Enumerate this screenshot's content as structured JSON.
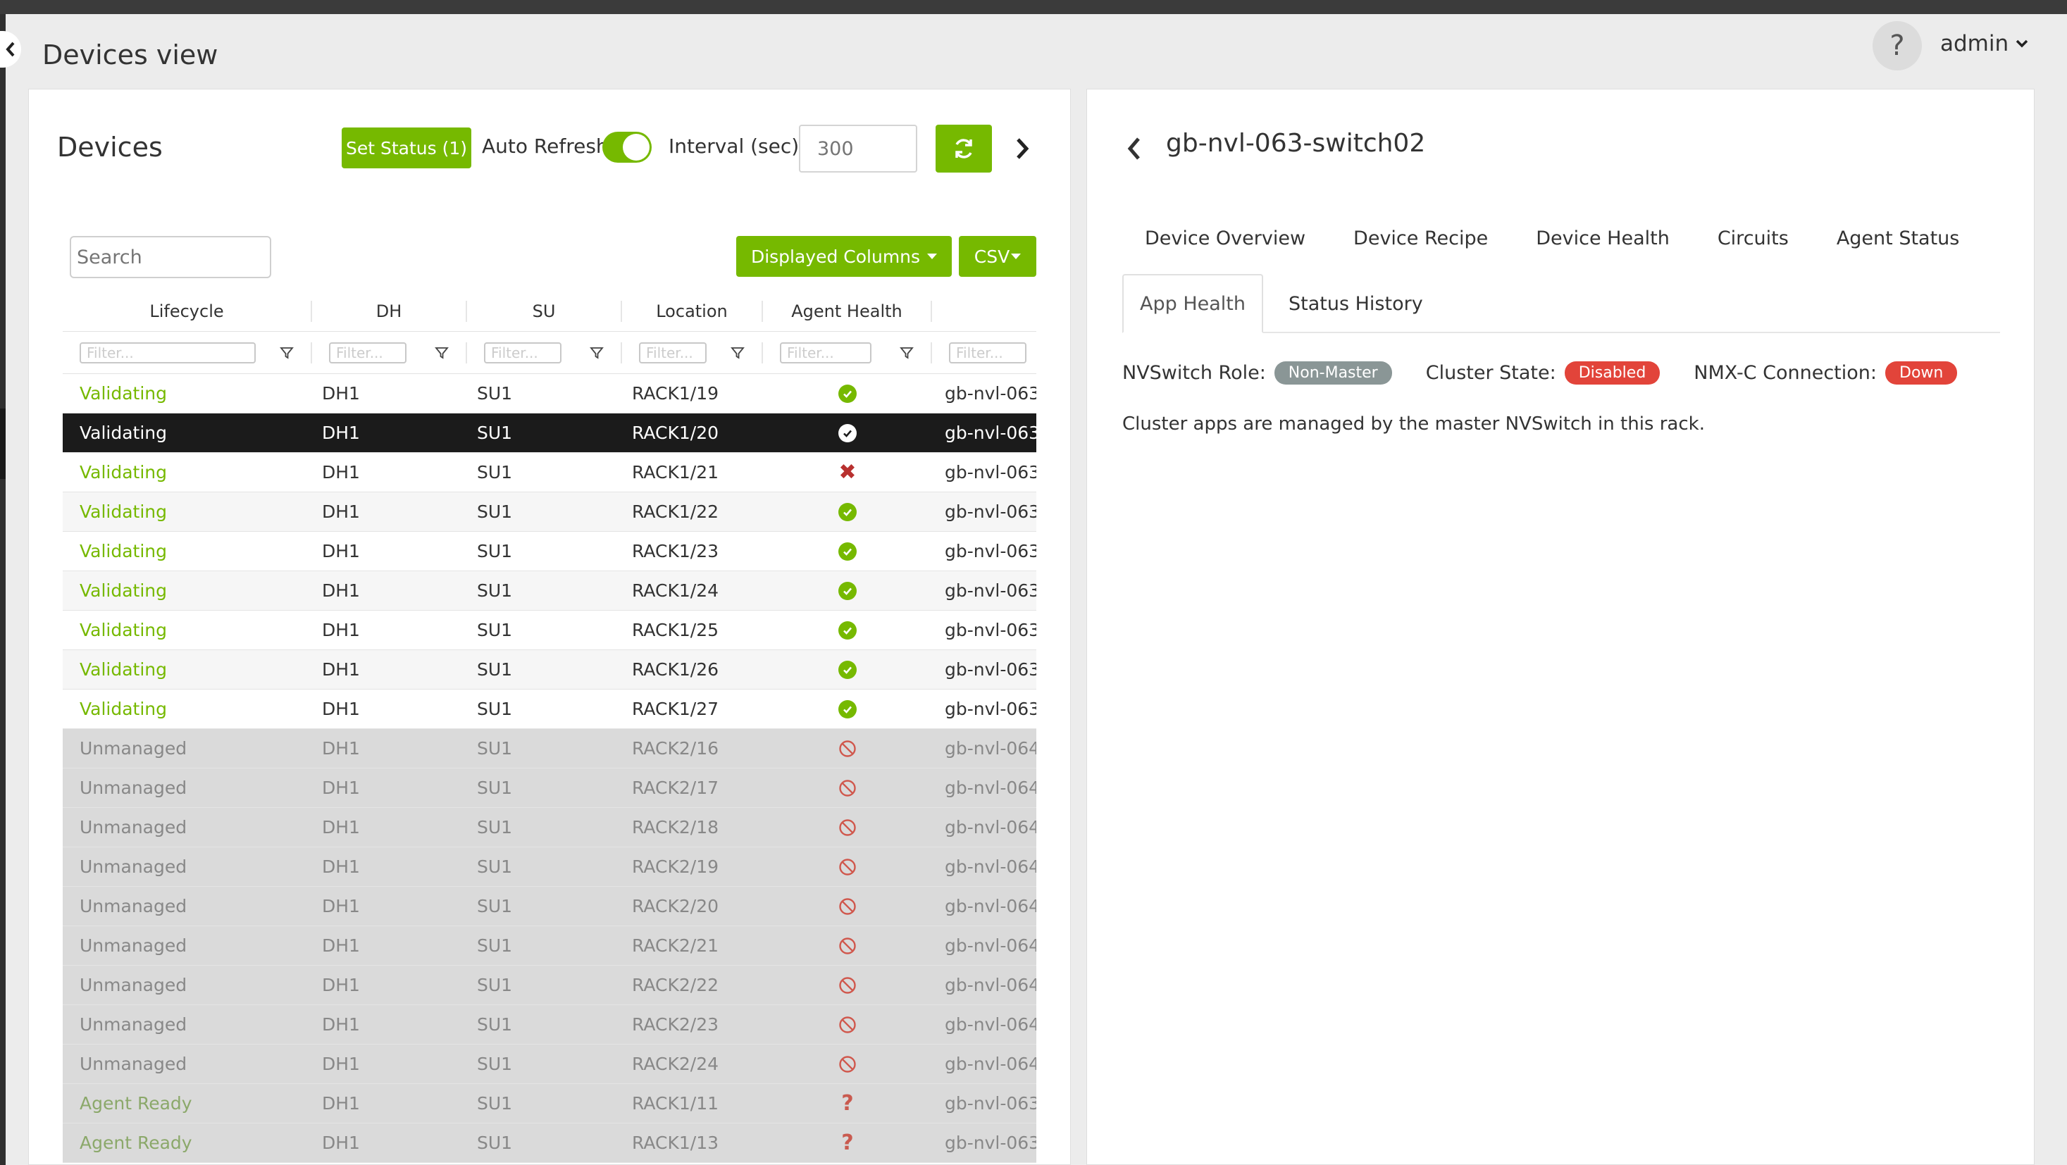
{
  "header": {
    "title": "Devices view",
    "help_label": "?",
    "user": "admin"
  },
  "devices_panel": {
    "title": "Devices",
    "set_status_label": "Set Status (1)",
    "auto_refresh_label": "Auto Refresh",
    "auto_refresh_on": true,
    "interval_label": "Interval (sec)",
    "interval_placeholder": "300",
    "search_placeholder": "Search",
    "displayed_columns_label": "Displayed Columns",
    "csv_label": "CSV",
    "columns": [
      "Lifecycle",
      "DH",
      "SU",
      "Location",
      "Agent Health"
    ],
    "filter_placeholder": "Filter...",
    "rows": [
      {
        "lifecycle": "Validating",
        "dh": "DH1",
        "su": "SU1",
        "location": "RACK1/19",
        "health": "ok",
        "name": "gb-nvl-063"
      },
      {
        "lifecycle": "Validating",
        "dh": "DH1",
        "su": "SU1",
        "location": "RACK1/20",
        "health": "ok",
        "name": "gb-nvl-063"
      },
      {
        "lifecycle": "Validating",
        "dh": "DH1",
        "su": "SU1",
        "location": "RACK1/21",
        "health": "fail",
        "name": "gb-nvl-063"
      },
      {
        "lifecycle": "Validating",
        "dh": "DH1",
        "su": "SU1",
        "location": "RACK1/22",
        "health": "ok",
        "name": "gb-nvl-063"
      },
      {
        "lifecycle": "Validating",
        "dh": "DH1",
        "su": "SU1",
        "location": "RACK1/23",
        "health": "ok",
        "name": "gb-nvl-063"
      },
      {
        "lifecycle": "Validating",
        "dh": "DH1",
        "su": "SU1",
        "location": "RACK1/24",
        "health": "ok",
        "name": "gb-nvl-063"
      },
      {
        "lifecycle": "Validating",
        "dh": "DH1",
        "su": "SU1",
        "location": "RACK1/25",
        "health": "ok",
        "name": "gb-nvl-063"
      },
      {
        "lifecycle": "Validating",
        "dh": "DH1",
        "su": "SU1",
        "location": "RACK1/26",
        "health": "ok",
        "name": "gb-nvl-063"
      },
      {
        "lifecycle": "Validating",
        "dh": "DH1",
        "su": "SU1",
        "location": "RACK1/27",
        "health": "ok",
        "name": "gb-nvl-063"
      },
      {
        "lifecycle": "Unmanaged",
        "dh": "DH1",
        "su": "SU1",
        "location": "RACK2/16",
        "health": "disabled",
        "name": "gb-nvl-064"
      },
      {
        "lifecycle": "Unmanaged",
        "dh": "DH1",
        "su": "SU1",
        "location": "RACK2/17",
        "health": "disabled",
        "name": "gb-nvl-064"
      },
      {
        "lifecycle": "Unmanaged",
        "dh": "DH1",
        "su": "SU1",
        "location": "RACK2/18",
        "health": "disabled",
        "name": "gb-nvl-064"
      },
      {
        "lifecycle": "Unmanaged",
        "dh": "DH1",
        "su": "SU1",
        "location": "RACK2/19",
        "health": "disabled",
        "name": "gb-nvl-064"
      },
      {
        "lifecycle": "Unmanaged",
        "dh": "DH1",
        "su": "SU1",
        "location": "RACK2/20",
        "health": "disabled",
        "name": "gb-nvl-064"
      },
      {
        "lifecycle": "Unmanaged",
        "dh": "DH1",
        "su": "SU1",
        "location": "RACK2/21",
        "health": "disabled",
        "name": "gb-nvl-064"
      },
      {
        "lifecycle": "Unmanaged",
        "dh": "DH1",
        "su": "SU1",
        "location": "RACK2/22",
        "health": "disabled",
        "name": "gb-nvl-064"
      },
      {
        "lifecycle": "Unmanaged",
        "dh": "DH1",
        "su": "SU1",
        "location": "RACK2/23",
        "health": "disabled",
        "name": "gb-nvl-064"
      },
      {
        "lifecycle": "Unmanaged",
        "dh": "DH1",
        "su": "SU1",
        "location": "RACK2/24",
        "health": "disabled",
        "name": "gb-nvl-064"
      },
      {
        "lifecycle": "Agent Ready",
        "dh": "DH1",
        "su": "SU1",
        "location": "RACK1/11",
        "health": "unknown",
        "name": "gb-nvl-063"
      },
      {
        "lifecycle": "Agent Ready",
        "dh": "DH1",
        "su": "SU1",
        "location": "RACK1/13",
        "health": "unknown",
        "name": "gb-nvl-063"
      }
    ],
    "selected_row_index": 1
  },
  "detail_panel": {
    "title": "gb-nvl-063-switch02",
    "tabs": [
      "Device Overview",
      "Device Recipe",
      "Device Health",
      "Circuits",
      "Agent Status"
    ],
    "subtabs": [
      "App Health",
      "Status History"
    ],
    "nvswitch_role_label": "NVSwitch Role:",
    "nvswitch_role_value": "Non-Master",
    "cluster_state_label": "Cluster State:",
    "cluster_state_value": "Disabled",
    "nmxc_label": "NMX-C Connection:",
    "nmxc_value": "Down",
    "note": "Cluster apps are managed by the master NVSwitch in this rack."
  },
  "colors": {
    "accent": "#76b900",
    "danger": "#e2443a",
    "neutral_badge": "#8a9696"
  }
}
